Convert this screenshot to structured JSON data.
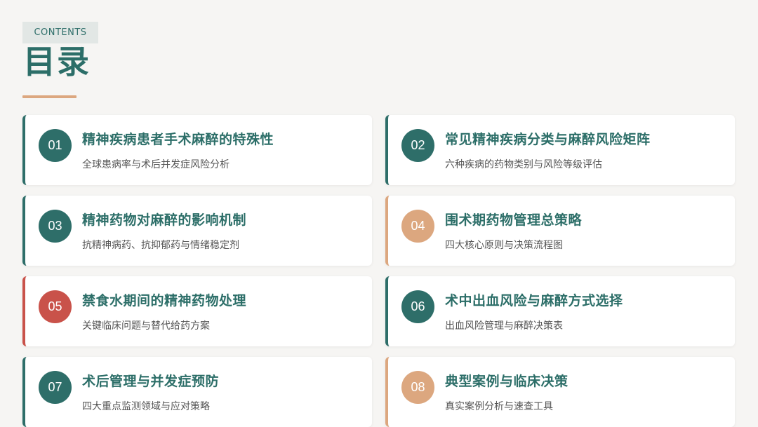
{
  "header": {
    "badge": "CONTENTS",
    "title": "目录"
  },
  "colors": {
    "teal": "#2e6e69",
    "orange": "#dca77f",
    "red": "#c9524a"
  },
  "items": [
    {
      "number": "01",
      "title": "精神疾病患者手术麻醉的特殊性",
      "subtitle": "全球患病率与术后并发症风险分析",
      "accent": "#2e6e69"
    },
    {
      "number": "02",
      "title": "常见精神疾病分类与麻醉风险矩阵",
      "subtitle": "六种疾病的药物类别与风险等级评估",
      "accent": "#2e6e69"
    },
    {
      "number": "03",
      "title": "精神药物对麻醉的影响机制",
      "subtitle": "抗精神病药、抗抑郁药与情绪稳定剂",
      "accent": "#2e6e69"
    },
    {
      "number": "04",
      "title": "围术期药物管理总策略",
      "subtitle": "四大核心原则与决策流程图",
      "accent": "#dca77f"
    },
    {
      "number": "05",
      "title": "禁食水期间的精神药物处理",
      "subtitle": "关键临床问题与替代给药方案",
      "accent": "#c9524a"
    },
    {
      "number": "06",
      "title": "术中出血风险与麻醉方式选择",
      "subtitle": "出血风险管理与麻醉决策表",
      "accent": "#2e6e69"
    },
    {
      "number": "07",
      "title": "术后管理与并发症预防",
      "subtitle": "四大重点监测领域与应对策略",
      "accent": "#2e6e69"
    },
    {
      "number": "08",
      "title": "典型案例与临床决策",
      "subtitle": "真实案例分析与速查工具",
      "accent": "#dca77f"
    }
  ]
}
